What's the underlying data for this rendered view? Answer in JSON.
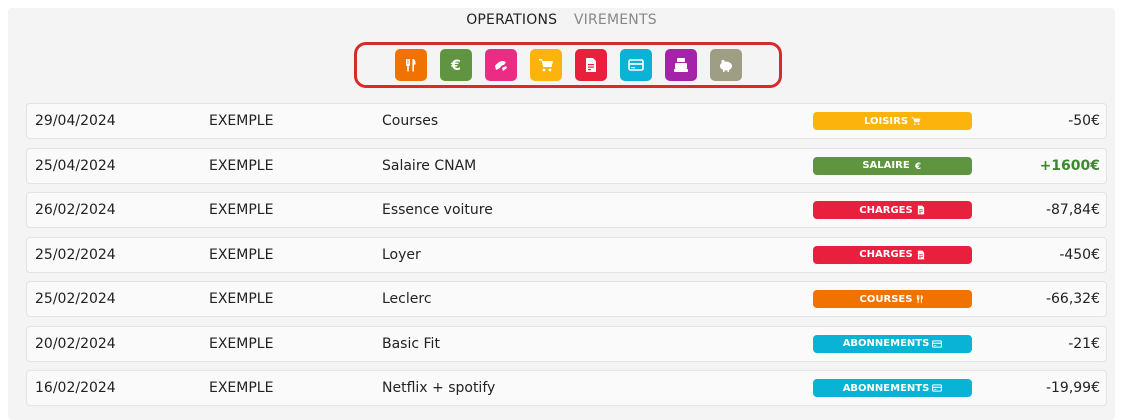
{
  "tabs": [
    {
      "label": "OPERATIONS",
      "active": true
    },
    {
      "label": "VIREMENTS",
      "active": false
    }
  ],
  "categories": [
    {
      "icon": "utensils-icon",
      "color": "#f07200"
    },
    {
      "icon": "euro-icon",
      "color": "#5f9540"
    },
    {
      "icon": "gift-icon",
      "color": "#ec2b84"
    },
    {
      "icon": "cart-icon",
      "color": "#fcb30b"
    },
    {
      "icon": "invoice-icon",
      "color": "#e8203d"
    },
    {
      "icon": "card-icon",
      "color": "#08b3d6"
    },
    {
      "icon": "cash-register-icon",
      "color": "#a523a6"
    },
    {
      "icon": "piggy-bank-icon",
      "color": "#9e9e85"
    }
  ],
  "operations": [
    {
      "date": "29/04/2024",
      "owner": "EXEMPLE",
      "label": "Courses",
      "category": "LOISIRS",
      "category_icon": "cart-icon",
      "category_color": "#fcb30b",
      "amount": "-50€",
      "positive": false
    },
    {
      "date": "25/04/2024",
      "owner": "EXEMPLE",
      "label": "Salaire CNAM",
      "category": "SALAIRE",
      "category_icon": "euro-icon",
      "category_color": "#5f9540",
      "amount": "+1600€",
      "positive": true
    },
    {
      "date": "26/02/2024",
      "owner": "EXEMPLE",
      "label": "Essence voiture",
      "category": "CHARGES",
      "category_icon": "invoice-icon",
      "category_color": "#e8203d",
      "amount": "-87,84€",
      "positive": false
    },
    {
      "date": "25/02/2024",
      "owner": "EXEMPLE",
      "label": "Loyer",
      "category": "CHARGES",
      "category_icon": "invoice-icon",
      "category_color": "#e8203d",
      "amount": "-450€",
      "positive": false
    },
    {
      "date": "25/02/2024",
      "owner": "EXEMPLE",
      "label": "Leclerc",
      "category": "COURSES",
      "category_icon": "utensils-icon",
      "category_color": "#f07200",
      "amount": "-66,32€",
      "positive": false
    },
    {
      "date": "20/02/2024",
      "owner": "EXEMPLE",
      "label": "Basic Fit",
      "category": "ABONNEMENTS",
      "category_icon": "card-icon",
      "category_color": "#08b3d6",
      "amount": "-21€",
      "positive": false
    },
    {
      "date": "16/02/2024",
      "owner": "EXEMPLE",
      "label": "Netflix + spotify",
      "category": "ABONNEMENTS",
      "category_icon": "card-icon",
      "category_color": "#08b3d6",
      "amount": "-19,99€",
      "positive": false
    }
  ]
}
